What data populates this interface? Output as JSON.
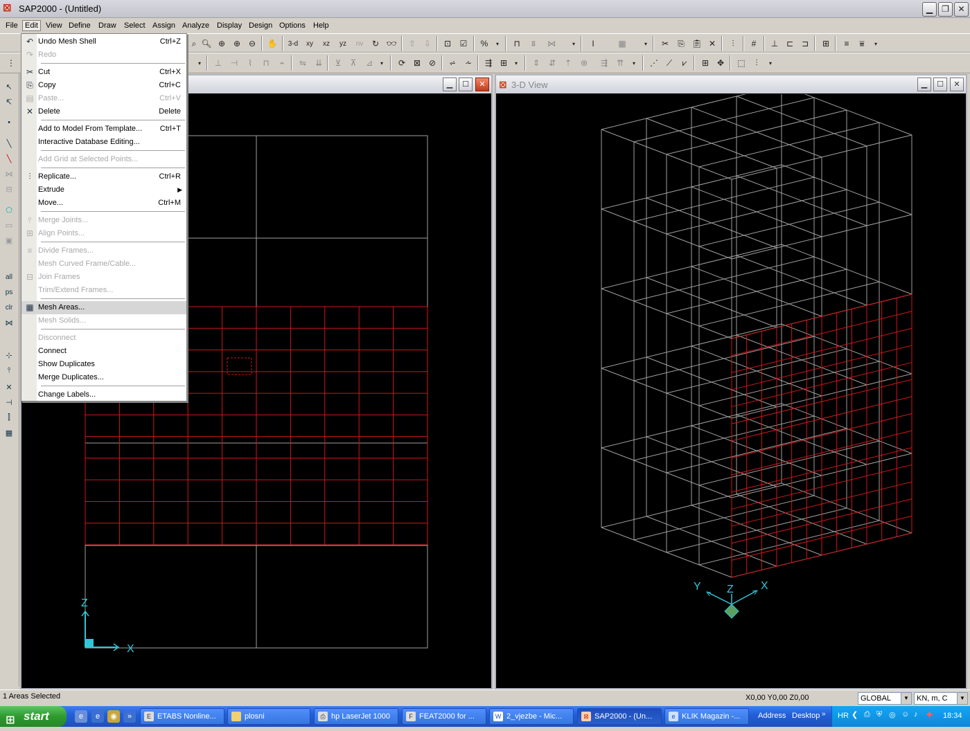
{
  "app": {
    "title": "SAP2000 - (Untitled)"
  },
  "menubar": [
    "File",
    "Edit",
    "View",
    "Define",
    "Draw",
    "Select",
    "Assign",
    "Analyze",
    "Display",
    "Design",
    "Options",
    "Help"
  ],
  "toolbar1_text": [
    "3-d",
    "xy",
    "xz",
    "yz",
    "nv"
  ],
  "edit_menu": [
    {
      "label": "Undo Mesh Shell",
      "shortcut": "Ctrl+Z",
      "enabled": true,
      "icon": "undo-icon"
    },
    {
      "label": "Redo",
      "shortcut": "",
      "enabled": false,
      "icon": "redo-icon"
    },
    {
      "label": "Cut",
      "shortcut": "Ctrl+X",
      "enabled": true,
      "icon": "scissors-icon"
    },
    {
      "label": "Copy",
      "shortcut": "Ctrl+C",
      "enabled": true,
      "icon": "copy-icon"
    },
    {
      "label": "Paste...",
      "shortcut": "Ctrl+V",
      "enabled": false,
      "icon": "paste-icon"
    },
    {
      "label": "Delete",
      "shortcut": "Delete",
      "enabled": true,
      "icon": "delete-x-icon"
    },
    {
      "label": "Add to Model From Template...",
      "shortcut": "Ctrl+T",
      "enabled": true,
      "icon": ""
    },
    {
      "label": "Interactive Database Editing...",
      "shortcut": "",
      "enabled": true,
      "icon": ""
    },
    {
      "label": "Add Grid at Selected Points...",
      "shortcut": "",
      "enabled": false,
      "icon": ""
    },
    {
      "label": "Replicate...",
      "shortcut": "Ctrl+R",
      "enabled": true,
      "icon": "replicate-icon"
    },
    {
      "label": "Extrude",
      "shortcut": "",
      "enabled": true,
      "icon": "",
      "submenu": true
    },
    {
      "label": "Move...",
      "shortcut": "Ctrl+M",
      "enabled": true,
      "icon": ""
    },
    {
      "label": "Merge Joints...",
      "shortcut": "",
      "enabled": false,
      "icon": "merge-joints-icon"
    },
    {
      "label": "Align Points...",
      "shortcut": "",
      "enabled": false,
      "icon": "align-points-icon"
    },
    {
      "label": "Divide Frames...",
      "shortcut": "",
      "enabled": false,
      "icon": "divide-frames-icon"
    },
    {
      "label": "Mesh Curved Frame/Cable...",
      "shortcut": "",
      "enabled": false,
      "icon": ""
    },
    {
      "label": "Join Frames",
      "shortcut": "",
      "enabled": false,
      "icon": "join-frames-icon"
    },
    {
      "label": "Trim/Extend Frames...",
      "shortcut": "",
      "enabled": false,
      "icon": ""
    },
    {
      "label": "Mesh Areas...",
      "shortcut": "",
      "enabled": true,
      "icon": "mesh-areas-icon",
      "highlighted": true
    },
    {
      "label": "Mesh Solids...",
      "shortcut": "",
      "enabled": false,
      "icon": ""
    },
    {
      "label": "Disconnect",
      "shortcut": "",
      "enabled": false,
      "icon": ""
    },
    {
      "label": "Connect",
      "shortcut": "",
      "enabled": true,
      "icon": ""
    },
    {
      "label": "Show Duplicates",
      "shortcut": "",
      "enabled": true,
      "icon": ""
    },
    {
      "label": "Merge Duplicates...",
      "shortcut": "",
      "enabled": true,
      "icon": ""
    },
    {
      "label": "Change Labels...",
      "shortcut": "",
      "enabled": true,
      "icon": ""
    }
  ],
  "views": {
    "left": {
      "title": ""
    },
    "right": {
      "title": "3-D View"
    }
  },
  "axes": {
    "x": "X",
    "y": "Y",
    "z": "Z"
  },
  "status": {
    "text": "1 Areas Selected",
    "coords": "X0,00  Y0,00  Z0,00",
    "coord_system": "GLOBAL",
    "units": "KN, m, C"
  },
  "taskbar": {
    "start": "start",
    "tasks": [
      "ETABS Nonline...",
      "plosni",
      "hp LaserJet 1000",
      "FEAT2000 for ...",
      "2_vjezbe - Mic...",
      "SAP2000 - (Un...",
      "KLIK Magazin -..."
    ],
    "address": "Address",
    "desktop": "Desktop",
    "lang": "HR",
    "clock": "18:34"
  },
  "colors": {
    "mesh_red": "#d01818",
    "grid_grey": "#a0a0a0",
    "axis_cyan": "#30c8d8"
  }
}
